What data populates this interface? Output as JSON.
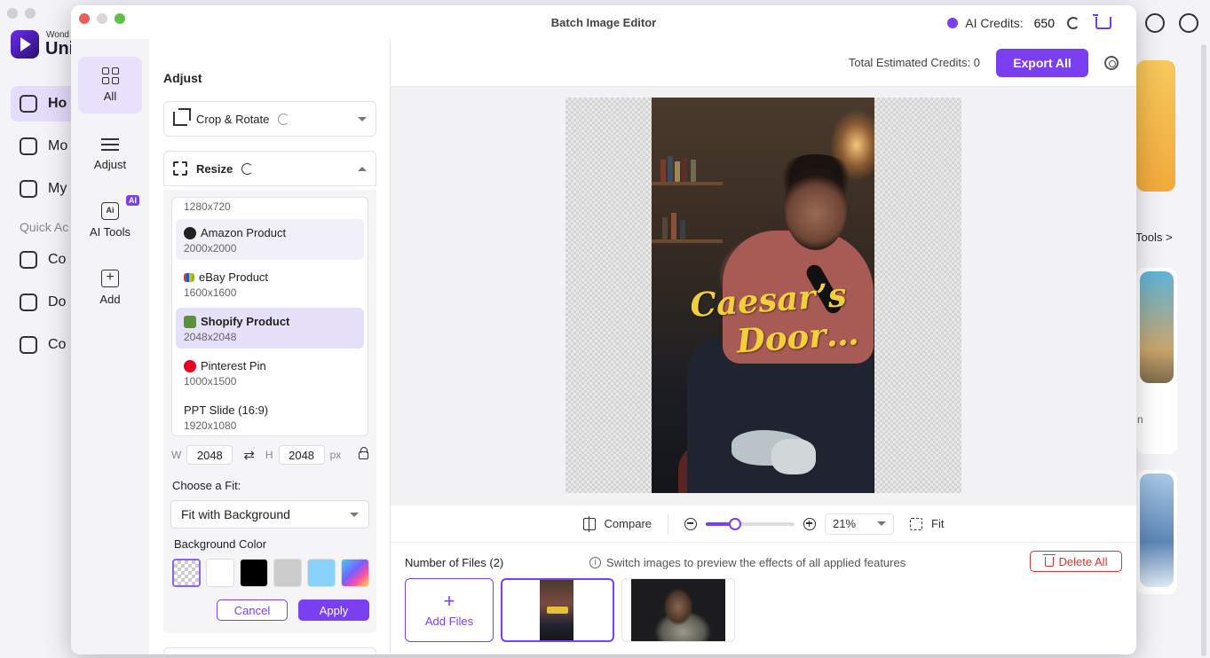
{
  "background_app": {
    "brand_small": "Wond",
    "brand": "Uni",
    "nav": [
      {
        "label": "Ho"
      },
      {
        "label": "Mo"
      },
      {
        "label": "My"
      }
    ],
    "section": "Quick Ac",
    "quick": [
      {
        "label": "Co"
      },
      {
        "label": "Do"
      },
      {
        "label": "Co"
      }
    ],
    "tools_link": "Tools >",
    "partial_letter": "n"
  },
  "window": {
    "title": "Batch Image Editor",
    "credits_label": "AI Credits:",
    "credits_value": "650"
  },
  "rail": {
    "items": [
      {
        "label": "All",
        "icon": "grid-icon",
        "active": true
      },
      {
        "label": "Adjust",
        "icon": "sliders-icon"
      },
      {
        "label": "AI Tools",
        "icon": "ai-tools-icon",
        "badge": "AI"
      },
      {
        "label": "Add",
        "icon": "add-icon"
      }
    ]
  },
  "panel": {
    "title": "Adjust",
    "crop": {
      "label": "Crop & Rotate",
      "icon": "crop-icon"
    },
    "resize": {
      "label": "Resize",
      "icon": "resize-icon",
      "partial_dim": "1280x720",
      "presets": [
        {
          "name": "Amazon Product",
          "dim": "2000x2000",
          "icon": "amazon-icon"
        },
        {
          "name": "eBay Product",
          "dim": "1600x1600",
          "icon": "ebay-icon"
        },
        {
          "name": "Shopify Product",
          "dim": "2048x2048",
          "icon": "shopify-icon",
          "selected": true
        },
        {
          "name": "Pinterest Pin",
          "dim": "1000x1500",
          "icon": "pinterest-icon"
        },
        {
          "name": "PPT Slide (16:9)",
          "dim": "1920x1080"
        }
      ],
      "w_label": "W",
      "w_value": "2048",
      "h_label": "H",
      "h_value": "2048",
      "unit": "px",
      "fit_label": "Choose a Fit:",
      "fit_value": "Fit with Background",
      "bg_color_label": "Background Color",
      "swatches": [
        "transparent",
        "#ffffff",
        "#000000",
        "#cccccc",
        "#89d3fb",
        "gradient"
      ],
      "cancel": "Cancel",
      "apply": "Apply"
    }
  },
  "main": {
    "estimated_label": "Total Estimated Credits:",
    "estimated_value": "0",
    "export_all": "Export All",
    "preview_caption": {
      "line1": "Caesar’s",
      "line2": "Door…"
    },
    "zoom": {
      "compare": "Compare",
      "zoom_fraction": 0.33,
      "zoom_value": "21%",
      "fit": "Fit"
    },
    "files": {
      "count_label": "Number of Files (2)",
      "hint": "Switch images to preview the effects of all applied features",
      "delete_all": "Delete All",
      "add_files": "Add Files"
    }
  },
  "colors": {
    "accent": "#7b3ff2",
    "danger": "#dd3333",
    "caption": "#f3cf3a"
  }
}
